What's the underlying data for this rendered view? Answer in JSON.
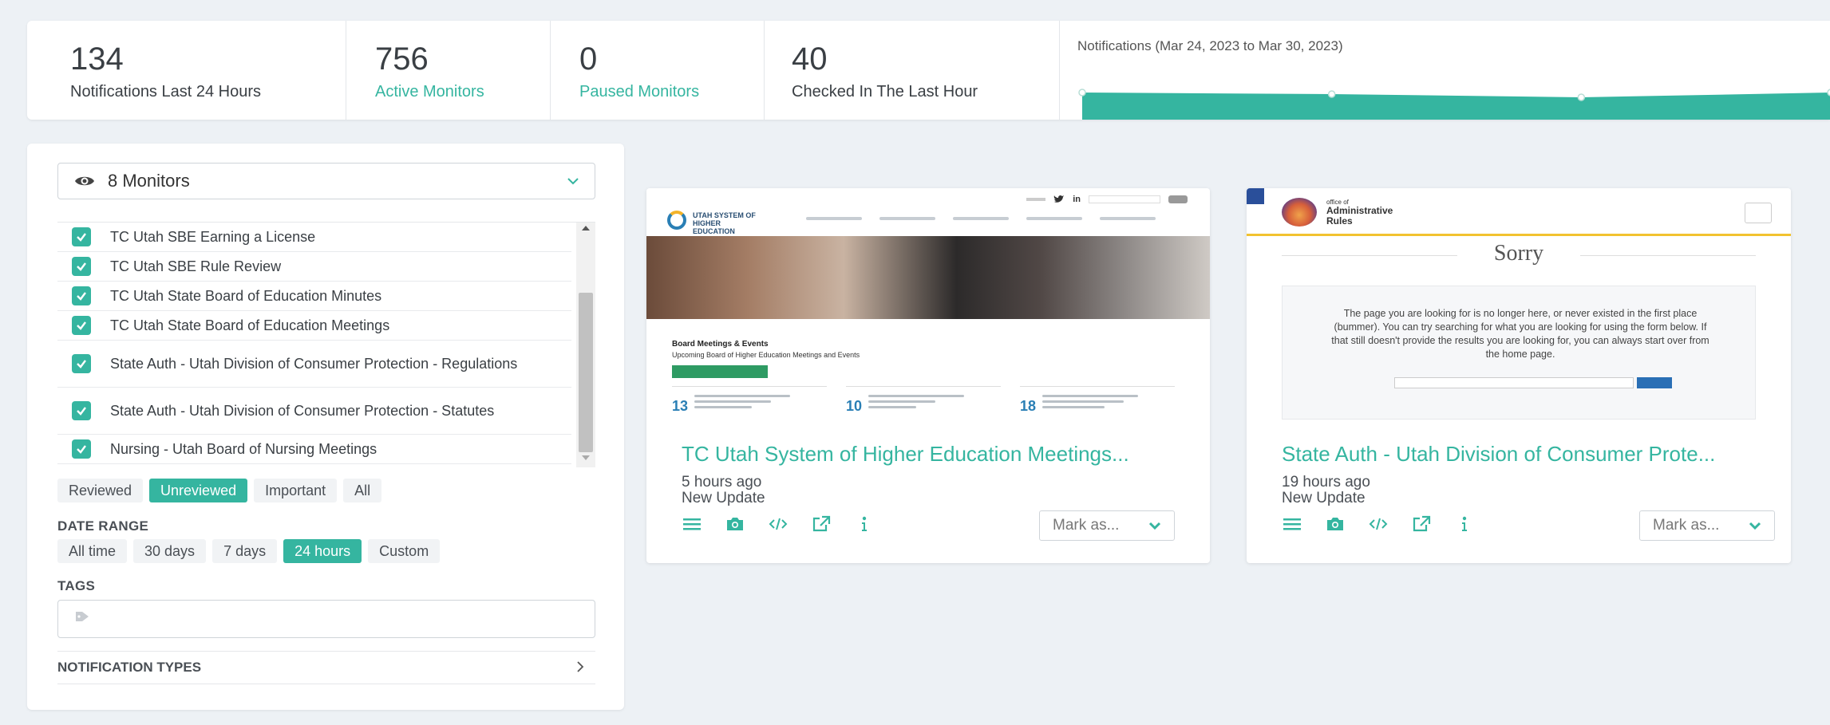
{
  "stats": {
    "notifications_24h": {
      "value": "134",
      "label": "Notifications Last 24 Hours"
    },
    "active_monitors": {
      "value": "756",
      "label": "Active Monitors"
    },
    "paused_monitors": {
      "value": "0",
      "label": "Paused Monitors"
    },
    "checked_last_hour": {
      "value": "40",
      "label": "Checked In The Last Hour"
    },
    "sparkline_title": "Notifications (Mar 24, 2023 to Mar 30, 2023)"
  },
  "sidebar": {
    "monitor_select": "8 Monitors",
    "monitors": [
      {
        "name": "TC Utah SBE Earning a License",
        "checked": true
      },
      {
        "name": "TC Utah SBE Rule Review",
        "checked": true
      },
      {
        "name": "TC Utah State Board of Education Minutes",
        "checked": true
      },
      {
        "name": "TC Utah State Board of Education Meetings",
        "checked": true
      },
      {
        "name": "State Auth - Utah Division of Consumer Protection - Regulations",
        "checked": true
      },
      {
        "name": "State Auth - Utah Division of Consumer Protection - Statutes",
        "checked": true
      },
      {
        "name": "Nursing - Utah Board of Nursing Meetings",
        "checked": true
      }
    ],
    "review_filters": [
      "Reviewed",
      "Unreviewed",
      "Important",
      "All"
    ],
    "active_review_filter": "Unreviewed",
    "date_range_label": "DATE RANGE",
    "date_ranges": [
      "All time",
      "30 days",
      "7 days",
      "24 hours",
      "Custom"
    ],
    "active_date_range": "24 hours",
    "tags_label": "TAGS",
    "notification_types_label": "NOTIFICATION TYPES"
  },
  "cards": [
    {
      "title": "TC Utah System of Higher Education Meetings...",
      "time": "5 hours ago",
      "update": "New Update",
      "mark_label": "Mark as...",
      "thumb": {
        "logo_text": "UTAH SYSTEM OF HIGHER EDUCATION",
        "heading": "Board Meetings & Events",
        "subheading": "Upcoming Board of Higher Education Meetings and Events",
        "event_days": [
          "13",
          "10",
          "18"
        ]
      }
    },
    {
      "title": "State Auth - Utah Division of Consumer Prote...",
      "time": "19 hours ago",
      "update": "New Update",
      "mark_label": "Mark as...",
      "thumb": {
        "logo_text_small": "office of",
        "logo_text_big": "Administrative",
        "logo_text_big2": "Rules",
        "sorry": "Sorry",
        "message": "The page you are looking for is no longer here, or never existed in the first place (bummer). You can try searching for what you are looking for using the form below. If that still doesn't provide the results you are looking for, you can always start over from the home page."
      }
    }
  ],
  "colors": {
    "accent": "#35b5a0"
  },
  "sparkline": {
    "values": [
      5,
      4,
      2,
      5
    ]
  }
}
